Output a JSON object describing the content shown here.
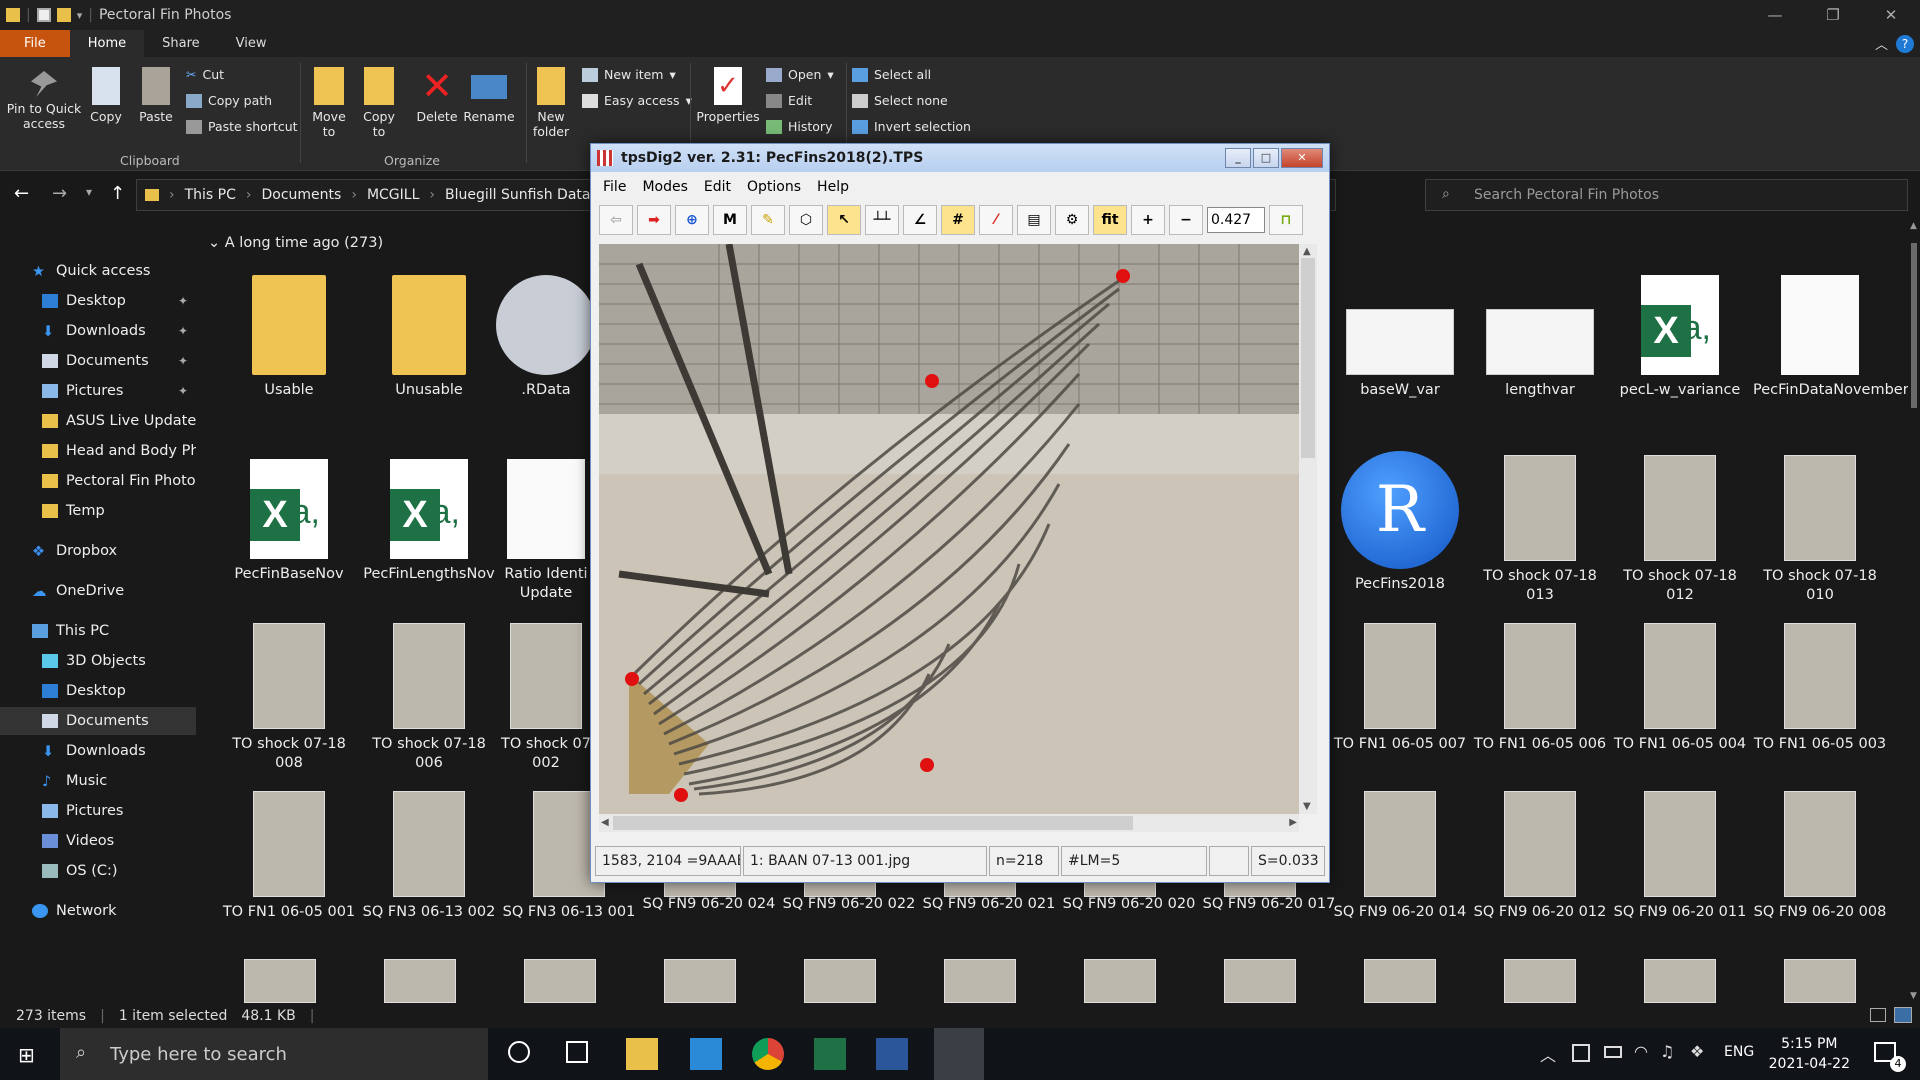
{
  "explorer": {
    "window_title": "Pectoral Fin Photos",
    "window_controls": {
      "minimize": "—",
      "maximize": "❐",
      "close": "✕"
    },
    "tabs": [
      "File",
      "Home",
      "Share",
      "View"
    ],
    "ribbon": {
      "pin": "Pin to Quick access",
      "copy": "Copy",
      "paste": "Paste",
      "cut": "Cut",
      "copy_path": "Copy path",
      "paste_shortcut": "Paste shortcut",
      "clipboard_group": "Clipboard",
      "move_to": "Move to",
      "copy_to": "Copy to",
      "delete": "Delete",
      "rename": "Rename",
      "organize_group": "Organize",
      "new_folder": "New folder",
      "new_item": "New item",
      "easy_access": "Easy access",
      "properties": "Properties",
      "open": "Open",
      "edit": "Edit",
      "history": "History",
      "select_all": "Select all",
      "select_none": "Select none",
      "invert_selection": "Invert selection"
    },
    "breadcrumb": [
      "This PC",
      "Documents",
      "MCGILL",
      "Bluegill Sunfish Data"
    ],
    "search_placeholder": "Search Pectoral Fin Photos",
    "nav": {
      "quick_access": "Quick access",
      "qa_items": [
        "Desktop",
        "Downloads",
        "Documents",
        "Pictures",
        "ASUS Live Update",
        "Head and Body Pho",
        "Pectoral Fin Photos",
        "Temp"
      ],
      "dropbox": "Dropbox",
      "onedrive": "OneDrive",
      "this_pc": "This PC",
      "pc_items": [
        "3D Objects",
        "Desktop",
        "Documents",
        "Downloads",
        "Music",
        "Pictures",
        "Videos",
        "OS (C:)"
      ],
      "network": "Network"
    },
    "group_header": "A long time ago (273)",
    "files_row1": [
      "Usable",
      "Unusable",
      ".RData",
      "baseW_var",
      "lengthvar",
      "pecL-w_variance",
      "PecFinDataNovember"
    ],
    "files_row2": [
      "PecFinBaseNov",
      "PecFinLengthsNov",
      "Ratio Identi Update",
      "PecFins2018",
      "TO shock 07-18 013",
      "TO shock 07-18 012",
      "TO shock 07-18 010"
    ],
    "files_row3": [
      "TO shock 07-18 008",
      "TO shock 07-18 006",
      "TO shock 07 002",
      "TO FN1 06-05 007",
      "TO FN1 06-05 006",
      "TO FN1 06-05 004",
      "TO FN1 06-05 003"
    ],
    "files_row4": [
      "TO FN1 06-05 001",
      "SQ FN3 06-13 002",
      "SQ FN3 06-13 001",
      "SQ FN9 06-20 024",
      "SQ FN9 06-20 022",
      "SQ FN9 06-20 021",
      "SQ FN9 06-20 020",
      "SQ FN9 06-20 017",
      "SQ FN9 06-20 014",
      "SQ FN9 06-20 012",
      "SQ FN9 06-20 011",
      "SQ FN9 06-20 008"
    ],
    "status": {
      "count": "273 items",
      "selected": "1 item selected",
      "size": "48.1 KB"
    }
  },
  "tps": {
    "title": "tpsDig2 ver. 2.31: PecFins2018(2).TPS",
    "menu": [
      "File",
      "Modes",
      "Edit",
      "Options",
      "Help"
    ],
    "toolbar": {
      "m": "M",
      "hash": "#",
      "fit": "fit",
      "plus": "+",
      "minus": "−"
    },
    "zoom": "0.427",
    "status": {
      "coords": "1583, 2104 =9AAAB6",
      "image": "1: BAAN 07-13 001.jpg",
      "n": "n=218",
      "lm": "#LM=5",
      "s": "S=0.033"
    },
    "landmark_color": "#e01010"
  },
  "taskbar": {
    "search_placeholder": "Type here to search",
    "lang": "ENG",
    "time": "5:15 PM",
    "date": "2021-04-22",
    "notif_count": "4"
  }
}
